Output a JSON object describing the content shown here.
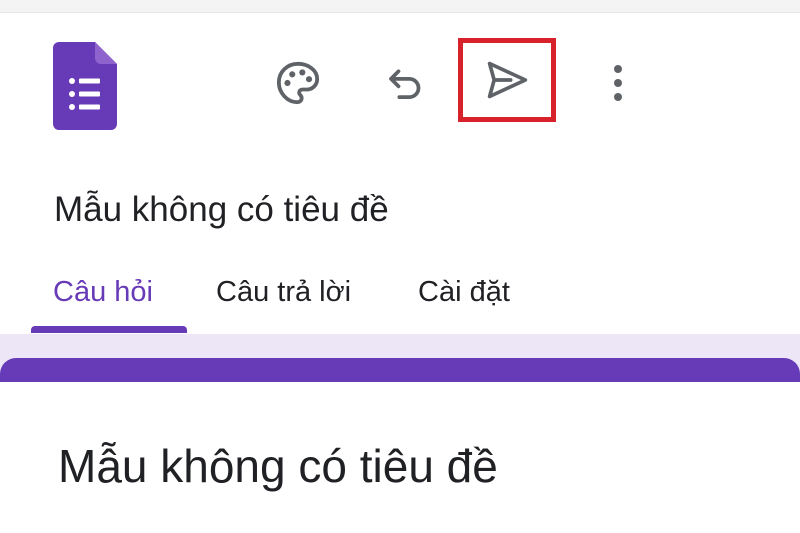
{
  "toolbar": {
    "logo_icon": "google-forms-logo-icon",
    "icons": [
      "palette-icon",
      "undo-icon",
      "send-icon",
      "more-vert-icon"
    ],
    "highlight_color": "#d7212b"
  },
  "form": {
    "title": "Mẫu không có tiêu đề"
  },
  "tabs": [
    {
      "label": "Câu hỏi",
      "active": true
    },
    {
      "label": "Câu trả lời",
      "active": false
    },
    {
      "label": "Cài đặt",
      "active": false
    }
  ],
  "card": {
    "title": "Mẫu không có tiêu đề"
  },
  "colors": {
    "accent": "#673ab7",
    "background": "#ede6f6",
    "text": "#202124",
    "icon": "#5f6368"
  }
}
